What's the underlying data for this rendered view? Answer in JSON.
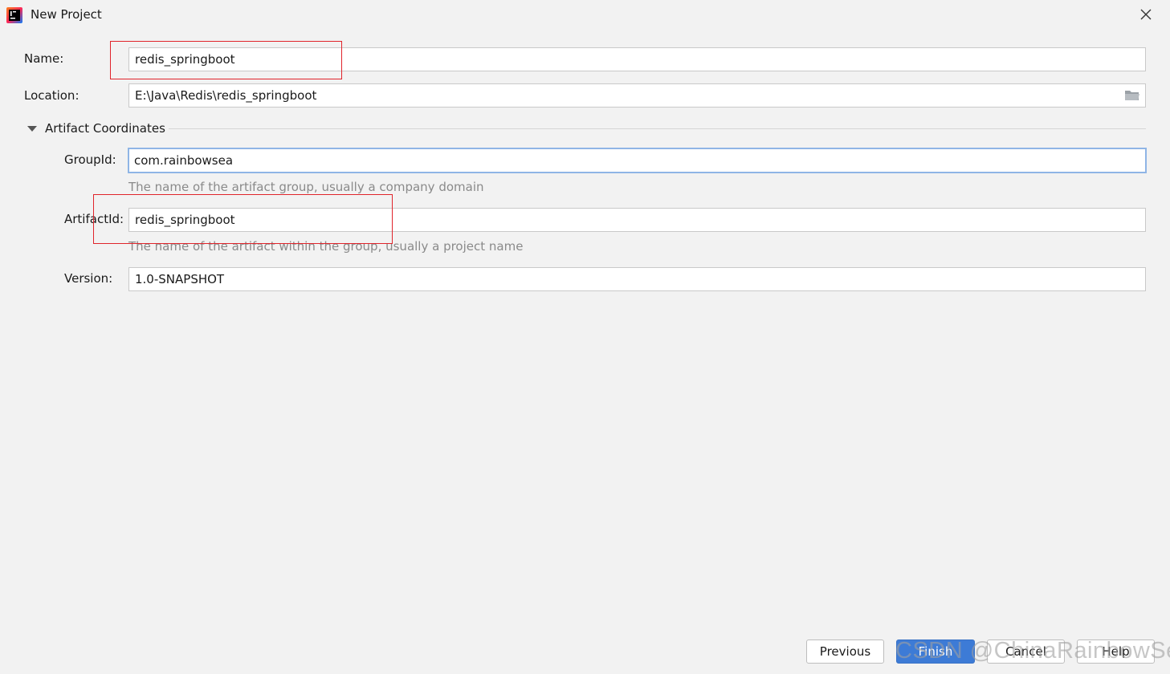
{
  "window": {
    "title": "New Project",
    "app_icon": "intellij-idea-icon",
    "close_icon": "close-icon"
  },
  "form": {
    "name": {
      "label": "Name:",
      "value": "redis_springboot"
    },
    "location": {
      "label": "Location:",
      "value": "E:\\Java\\Redis\\redis_springboot",
      "browse_icon": "folder-icon"
    },
    "section": {
      "label": "Artifact Coordinates",
      "expanded": true
    },
    "group_id": {
      "label": "GroupId:",
      "value": "com.rainbowsea",
      "hint": "The name of the artifact group, usually a company domain"
    },
    "artifact_id": {
      "label": "ArtifactId:",
      "value": "redis_springboot",
      "hint": "The name of the artifact within the group, usually a project name"
    },
    "version": {
      "label": "Version:",
      "value": "1.0-SNAPSHOT"
    }
  },
  "buttons": {
    "previous": "Previous",
    "finish": "Finish",
    "cancel": "Cancel",
    "help": "Help"
  },
  "watermark": "CSDN @ChinaRainbowSea",
  "colors": {
    "background": "#f2f2f2",
    "primary_button": "#3d7bd6",
    "focus_border": "#8fb5e6",
    "annotation_red": "#e0242b"
  }
}
